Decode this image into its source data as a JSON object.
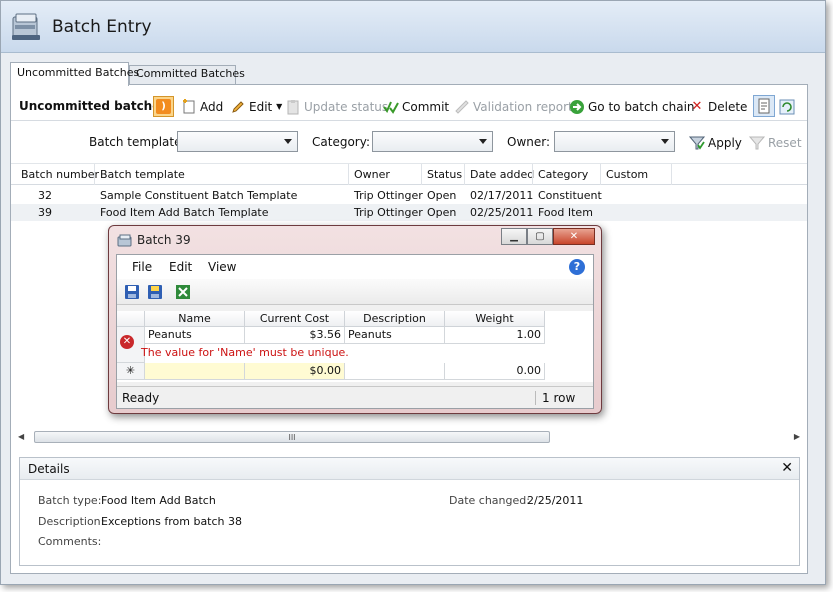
{
  "window": {
    "title": "Batch Entry"
  },
  "tabs": [
    {
      "label": "Uncommitted Batches",
      "active": true
    },
    {
      "label": "Committed Batches",
      "active": false
    }
  ],
  "toolbar": {
    "title": "Uncommitted batches",
    "add": "Add",
    "edit": "Edit",
    "update_status": "Update status",
    "commit": "Commit",
    "validation_report": "Validation report",
    "go_to_batch_chain": "Go to batch chain",
    "delete": "Delete"
  },
  "filters": {
    "batch_template_label": "Batch template:",
    "category_label": "Category:",
    "owner_label": "Owner:",
    "apply": "Apply",
    "reset": "Reset"
  },
  "grid": {
    "columns": [
      "Batch number",
      "Batch template",
      "Owner",
      "Status",
      "Date added",
      "Category",
      "Custom"
    ],
    "rows": [
      [
        "32",
        "Sample Constituent Batch Template",
        "Trip Ottinger",
        "Open",
        "02/17/2011",
        "Constituent",
        ""
      ],
      [
        "39",
        "Food Item Add Batch Template",
        "Trip Ottinger",
        "Open",
        "02/25/2011",
        "Food Item",
        ""
      ]
    ]
  },
  "scrollbar": {
    "grip": "III"
  },
  "details": {
    "title": "Details",
    "close": "✕",
    "batch_type_label": "Batch type:",
    "batch_type_value": "Food Item Add Batch",
    "description_label": "Description:",
    "description_value": "Exceptions from batch 38",
    "comments_label": "Comments:",
    "date_changed_label": "Date changed:",
    "date_changed_value": "2/25/2011"
  },
  "popup": {
    "title": "Batch 39",
    "menu": [
      "File",
      "Edit",
      "View"
    ],
    "help": "?",
    "columns": [
      "Name",
      "Current Cost",
      "Description",
      "Weight"
    ],
    "row1": {
      "name": "Peanuts",
      "cost": "$3.56",
      "description": "Peanuts",
      "weight": "1.00"
    },
    "error": "The value for 'Name' must be unique.",
    "new_row_marker": "✳",
    "new_row": {
      "name": "",
      "cost": "$0.00",
      "description": "",
      "weight": "0.00"
    },
    "status_left": "Ready",
    "status_right": "1 row"
  },
  "colors": {
    "accent": "#c9d9ec",
    "error": "#cc1111",
    "popup_frame": "#e7cbcd"
  }
}
